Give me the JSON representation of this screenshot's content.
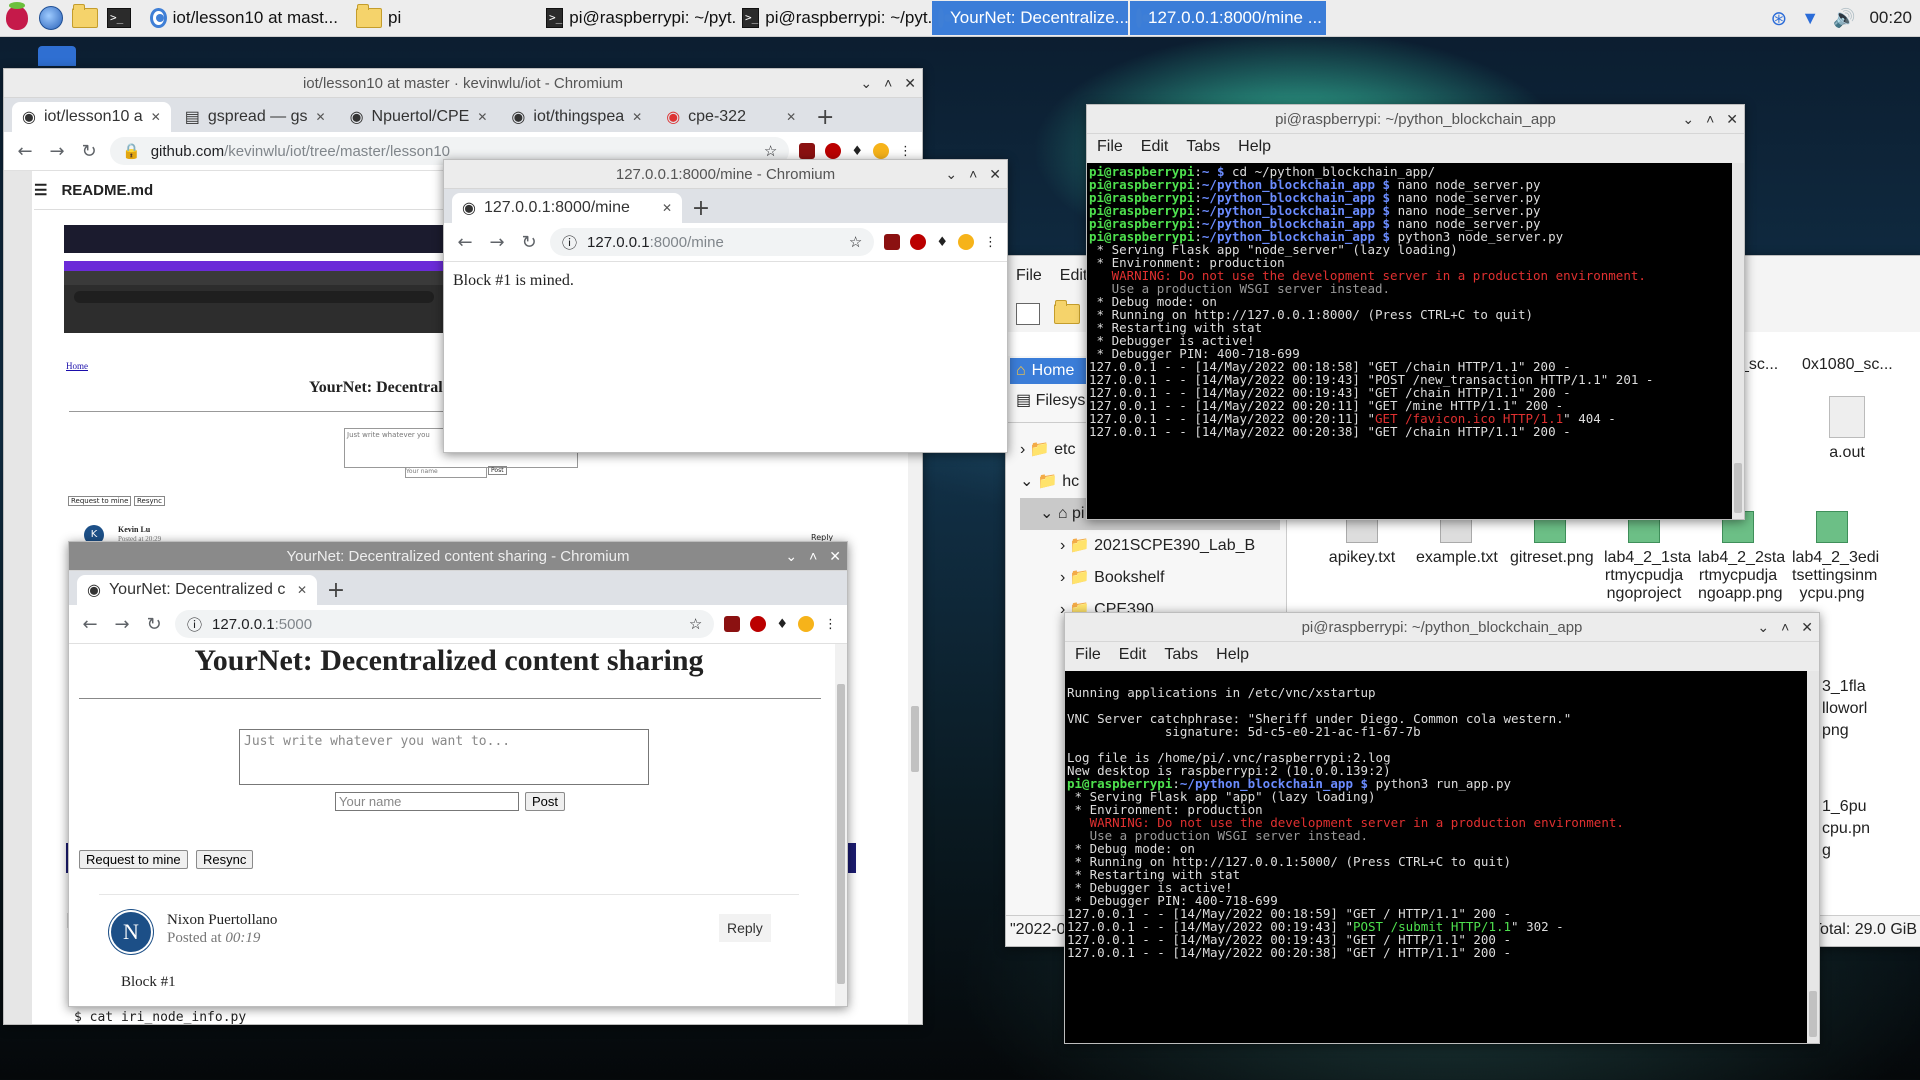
{
  "taskbar": {
    "tasks": [
      {
        "label": "iot/lesson10 at mast..."
      },
      {
        "label": "pi"
      },
      {
        "label": "pi@raspberrypi: ~/pyt..."
      },
      {
        "label": "pi@raspberrypi: ~/pyt..."
      },
      {
        "label": "YourNet: Decentralize..."
      },
      {
        "label": "127.0.0.1:8000/mine ..."
      }
    ],
    "clock": "00:20"
  },
  "github_window": {
    "title": "iot/lesson10 at master · kevinwlu/iot - Chromium",
    "tabs": [
      {
        "label": "iot/lesson10 a"
      },
      {
        "label": "gspread — gs"
      },
      {
        "label": "Npuertol/CPE"
      },
      {
        "label": "iot/thingspea"
      },
      {
        "label": "cpe-322"
      }
    ],
    "url_host": "github.com",
    "url_rest": "/kevinwlu/iot/tree/master/lesson10",
    "readme_label": "README.md",
    "bottom_cmd": "$ cat iri_node_info.py",
    "embedded": {
      "home_link": "Home",
      "heading": "YourNet: Decentral",
      "textarea_placeholder": "Just write whatever you",
      "name_placeholder": "Your name",
      "post": "Post",
      "request": "Request to mine",
      "resync": "Resync",
      "author": "Kevin Lu",
      "posted": "Posted at 20:29",
      "reply": "Reply"
    }
  },
  "mine_window": {
    "title": "127.0.0.1:8000/mine - Chromium",
    "tab_label": "127.0.0.1:8000/mine",
    "url_host": "127.0.0.1",
    "url_rest": ":8000/mine",
    "message": "Block #1 is mined."
  },
  "yournet_window": {
    "title": "YourNet: Decentralized content sharing - Chromium",
    "tab_label": "YourNet: Decentralized c",
    "url_host": "127.0.0.1",
    "url_rest": ":5000",
    "heading": "YourNet: Decentralized content sharing",
    "textarea_placeholder": "Just write whatever you want to...",
    "name_placeholder": "Your name",
    "post_button": "Post",
    "request_button": "Request to mine",
    "resync_button": "Resync",
    "post": {
      "avatar_letter": "N",
      "author": "Nixon Puertollano",
      "posted_prefix": "Posted at ",
      "posted_time": "00:19",
      "reply": "Reply",
      "content": "Block #1"
    }
  },
  "terminal_top": {
    "title": "pi@raspberrypi: ~/python_blockchain_app",
    "menu": [
      "File",
      "Edit",
      "Tabs",
      "Help"
    ],
    "lines": [
      [
        {
          "c": "g",
          "t": "pi@raspberrypi"
        },
        {
          "c": "",
          "t": ":"
        },
        {
          "c": "b",
          "t": "~ $"
        },
        {
          "c": "",
          "t": " cd ~/python_blockchain_app/"
        }
      ],
      [
        {
          "c": "g",
          "t": "pi@raspberrypi"
        },
        {
          "c": "",
          "t": ":"
        },
        {
          "c": "b",
          "t": "~/python_blockchain_app $"
        },
        {
          "c": "",
          "t": " nano node_server.py"
        }
      ],
      [
        {
          "c": "g",
          "t": "pi@raspberrypi"
        },
        {
          "c": "",
          "t": ":"
        },
        {
          "c": "b",
          "t": "~/python_blockchain_app $"
        },
        {
          "c": "",
          "t": " nano node_server.py"
        }
      ],
      [
        {
          "c": "g",
          "t": "pi@raspberrypi"
        },
        {
          "c": "",
          "t": ":"
        },
        {
          "c": "b",
          "t": "~/python_blockchain_app $"
        },
        {
          "c": "",
          "t": " nano node_server.py"
        }
      ],
      [
        {
          "c": "g",
          "t": "pi@raspberrypi"
        },
        {
          "c": "",
          "t": ":"
        },
        {
          "c": "b",
          "t": "~/python_blockchain_app $"
        },
        {
          "c": "",
          "t": " nano node_server.py"
        }
      ],
      [
        {
          "c": "g",
          "t": "pi@raspberrypi"
        },
        {
          "c": "",
          "t": ":"
        },
        {
          "c": "b",
          "t": "~/python_blockchain_app $"
        },
        {
          "c": "",
          "t": " python3 node_server.py"
        }
      ],
      [
        {
          "c": "",
          "t": " * Serving Flask app \"node_server\" (lazy loading)"
        }
      ],
      [
        {
          "c": "",
          "t": " * Environment: production"
        }
      ],
      [
        {
          "c": "r",
          "t": "   WARNING: Do not use the development server in a production environment."
        }
      ],
      [
        {
          "c": "d",
          "t": "   Use a production WSGI server instead."
        }
      ],
      [
        {
          "c": "",
          "t": " * Debug mode: on"
        }
      ],
      [
        {
          "c": "",
          "t": " * Running on http://127.0.0.1:8000/ (Press CTRL+C to quit)"
        }
      ],
      [
        {
          "c": "",
          "t": " * Restarting with stat"
        }
      ],
      [
        {
          "c": "",
          "t": " * Debugger is active!"
        }
      ],
      [
        {
          "c": "",
          "t": " * Debugger PIN: 400-718-699"
        }
      ],
      [
        {
          "c": "",
          "t": "127.0.0.1 - - [14/May/2022 00:18:58] \"GET /chain HTTP/1.1\" 200 -"
        }
      ],
      [
        {
          "c": "",
          "t": "127.0.0.1 - - [14/May/2022 00:19:43] \"POST /new_transaction HTTP/1.1\" 201 -"
        }
      ],
      [
        {
          "c": "",
          "t": "127.0.0.1 - - [14/May/2022 00:19:43] \"GET /chain HTTP/1.1\" 200 -"
        }
      ],
      [
        {
          "c": "",
          "t": "127.0.0.1 - - [14/May/2022 00:20:11] \"GET /mine HTTP/1.1\" 200 -"
        }
      ],
      [
        {
          "c": "",
          "t": "127.0.0.1 - - [14/May/2022 00:20:11] \""
        },
        {
          "c": "r",
          "t": "GET /favicon.ico HTTP/1.1"
        },
        {
          "c": "",
          "t": "\" 404 -"
        }
      ],
      [
        {
          "c": "",
          "t": "127.0.0.1 - - [14/May/2022 00:20:38] \"GET /chain HTTP/1.1\" 200 -"
        }
      ]
    ]
  },
  "terminal_bottom": {
    "title": "pi@raspberrypi: ~/python_blockchain_app",
    "menu": [
      "File",
      "Edit",
      "Tabs",
      "Help"
    ],
    "lines": [
      [
        {
          "c": "",
          "t": ""
        }
      ],
      [
        {
          "c": "",
          "t": "Running applications in /etc/vnc/xstartup"
        }
      ],
      [
        {
          "c": "",
          "t": ""
        }
      ],
      [
        {
          "c": "",
          "t": "VNC Server catchphrase: \"Sheriff under Diego. Common cola western.\""
        }
      ],
      [
        {
          "c": "",
          "t": "             signature: 5d-c5-e0-21-ac-f1-67-7b"
        }
      ],
      [
        {
          "c": "",
          "t": ""
        }
      ],
      [
        {
          "c": "",
          "t": "Log file is /home/pi/.vnc/raspberrypi:2.log"
        }
      ],
      [
        {
          "c": "",
          "t": "New desktop is raspberrypi:2 (10.0.0.139:2)"
        }
      ],
      [
        {
          "c": "g",
          "t": "pi@raspberrypi"
        },
        {
          "c": "",
          "t": ":"
        },
        {
          "c": "b",
          "t": "~/python_blockchain_app $"
        },
        {
          "c": "",
          "t": " python3 run_app.py"
        }
      ],
      [
        {
          "c": "",
          "t": " * Serving Flask app \"app\" (lazy loading)"
        }
      ],
      [
        {
          "c": "",
          "t": " * Environment: production"
        }
      ],
      [
        {
          "c": "r",
          "t": "   WARNING: Do not use the development server in a production environment."
        }
      ],
      [
        {
          "c": "d",
          "t": "   Use a production WSGI server instead."
        }
      ],
      [
        {
          "c": "",
          "t": " * Debug mode: on"
        }
      ],
      [
        {
          "c": "",
          "t": " * Running on http://127.0.0.1:5000/ (Press CTRL+C to quit)"
        }
      ],
      [
        {
          "c": "",
          "t": " * Restarting with stat"
        }
      ],
      [
        {
          "c": "",
          "t": " * Debugger is active!"
        }
      ],
      [
        {
          "c": "",
          "t": " * Debugger PIN: 400-718-699"
        }
      ],
      [
        {
          "c": "",
          "t": "127.0.0.1 - - [14/May/2022 00:18:59] \"GET / HTTP/1.1\" 200 -"
        }
      ],
      [
        {
          "c": "",
          "t": "127.0.0.1 - - [14/May/2022 00:19:43] \""
        },
        {
          "c": "gr",
          "t": "POST /submit HTTP/1.1"
        },
        {
          "c": "",
          "t": "\" 302 -"
        }
      ],
      [
        {
          "c": "",
          "t": "127.0.0.1 - - [14/May/2022 00:19:43] \"GET / HTTP/1.1\" 200 -"
        }
      ],
      [
        {
          "c": "",
          "t": "127.0.0.1 - - [14/May/2022 00:20:38] \"GET / HTTP/1.1\" 200 -"
        }
      ]
    ]
  },
  "file_manager": {
    "menu": [
      "File",
      "Edit"
    ],
    "places": [
      "Home",
      "Filesys"
    ],
    "tree": [
      "etc",
      "hc",
      "pi",
      "2021SCPE390_Lab_B",
      "Bookshelf",
      "CPE390"
    ],
    "status_left": "\"2022-0",
    "status_right": "(Total: 29.0 GiB",
    "files_top": [
      "_sc...",
      "0x1080_sc..."
    ],
    "aout": "a.out",
    "files": [
      {
        "name": "apikey.txt"
      },
      {
        "name": "example.txt"
      },
      {
        "name": "gitreset.png"
      },
      {
        "name": "lab4_2_1sta rtmycpudja ngoproject"
      },
      {
        "name": "lab4_2_2sta rtmycpudja ngoapp.png"
      },
      {
        "name": "lab4_2_3edi tsettingsinm ycpu.png"
      }
    ],
    "right_col": [
      "3_1fla lloworl png",
      "1_6pu cpu.pn g"
    ]
  }
}
